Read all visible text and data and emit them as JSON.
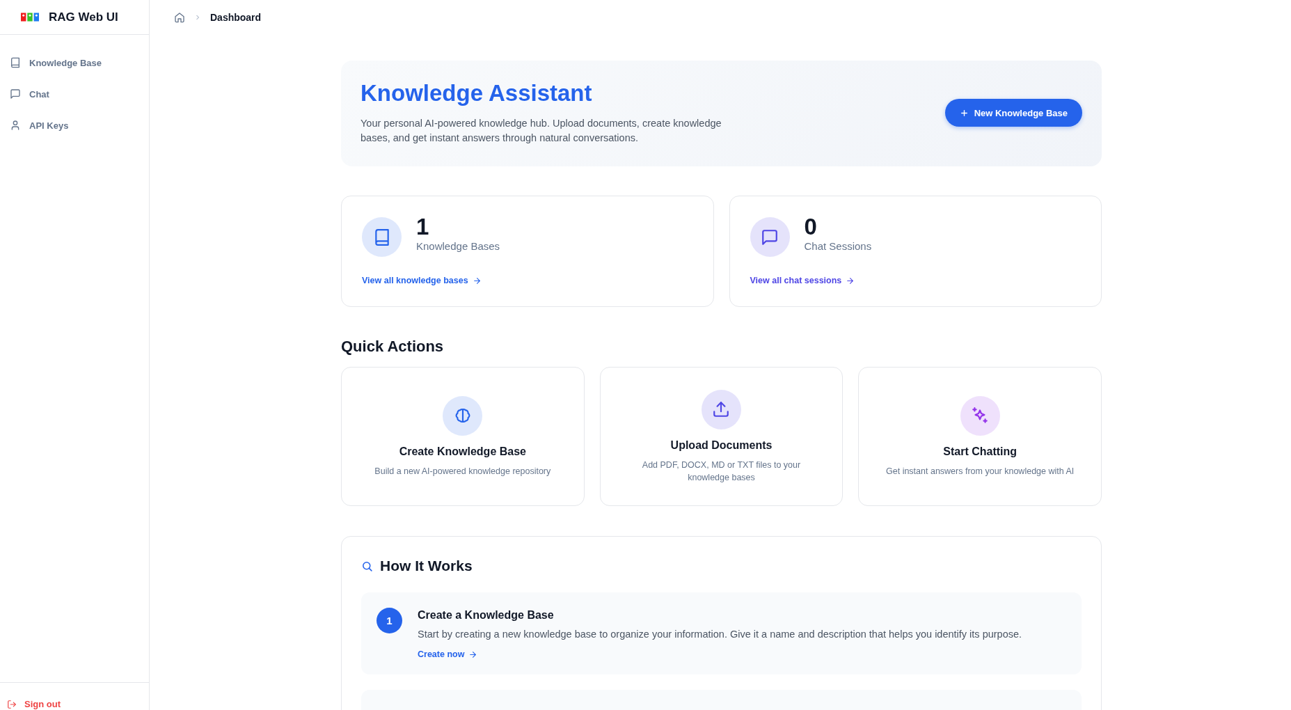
{
  "app": {
    "name": "RAG Web UI"
  },
  "sidebar": {
    "items": [
      {
        "label": "Knowledge Base",
        "selected": false
      },
      {
        "label": "Chat",
        "selected": false
      },
      {
        "label": "API Keys",
        "selected": false
      }
    ],
    "sign_out": "Sign out"
  },
  "breadcrumb": {
    "current": "Dashboard"
  },
  "hero": {
    "title": "Knowledge Assistant",
    "description": "Your personal AI-powered knowledge hub. Upload documents, create knowledge bases, and get instant answers through natural conversations.",
    "button": "New Knowledge Base"
  },
  "stats": [
    {
      "value": "1",
      "label": "Knowledge Bases",
      "link": "View all knowledge bases",
      "color": "#2563eb"
    },
    {
      "value": "0",
      "label": "Chat Sessions",
      "link": "View all chat sessions",
      "color": "#4f46e5"
    }
  ],
  "quick_actions": {
    "title": "Quick Actions",
    "items": [
      {
        "title": "Create Knowledge Base",
        "description": "Build a new AI-powered knowledge repository",
        "color": "#2563eb"
      },
      {
        "title": "Upload Documents",
        "description": "Add PDF, DOCX, MD or TXT files to your knowledge bases",
        "color": "#4f46e5"
      },
      {
        "title": "Start Chatting",
        "description": "Get instant answers from your knowledge with AI",
        "color": "#9333ea"
      }
    ]
  },
  "how_it_works": {
    "title": "How It Works",
    "steps": [
      {
        "number": "1",
        "title": "Create a Knowledge Base",
        "description": "Start by creating a new knowledge base to organize your information. Give it a name and description that helps you identify its purpose.",
        "link": "Create now"
      }
    ]
  }
}
